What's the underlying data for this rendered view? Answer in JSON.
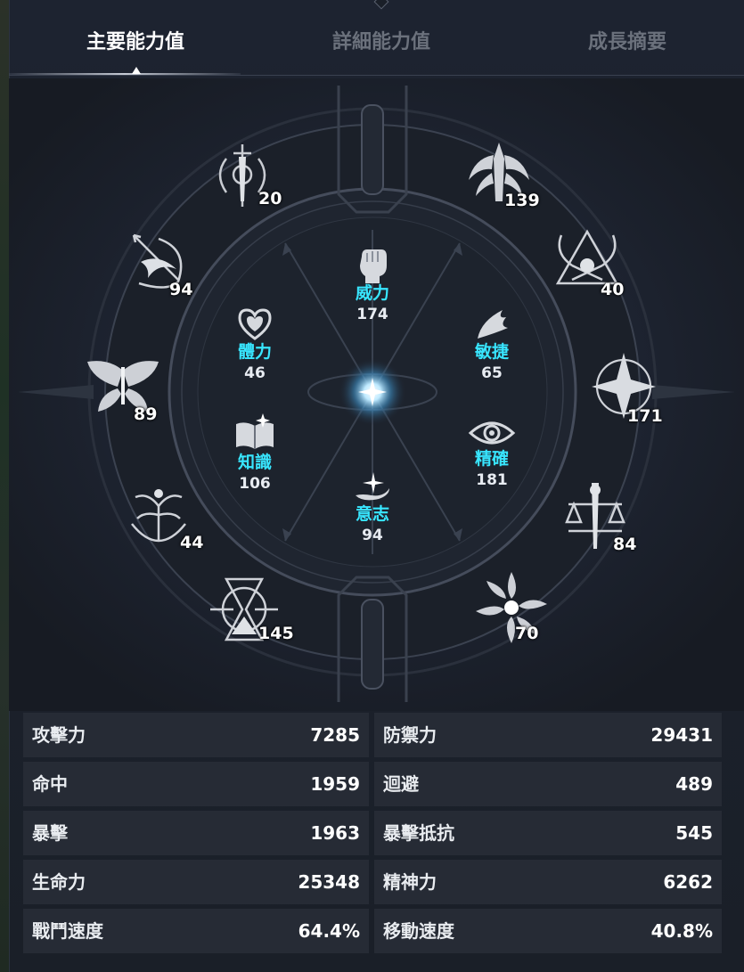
{
  "tabs": [
    {
      "label": "主要能力值",
      "active": true
    },
    {
      "label": "詳細能力值",
      "active": false
    },
    {
      "label": "成長摘要",
      "active": false
    }
  ],
  "outer_stats": [
    {
      "icon": "sword-crest-icon",
      "value": "20"
    },
    {
      "icon": "winged-blade-icon",
      "value": "139"
    },
    {
      "icon": "bow-arrow-icon",
      "value": "94"
    },
    {
      "icon": "crossed-scythes-icon",
      "value": "40"
    },
    {
      "icon": "butterfly-icon",
      "value": "89"
    },
    {
      "icon": "star-compass-icon",
      "value": "171"
    },
    {
      "icon": "tree-of-life-icon",
      "value": "44"
    },
    {
      "icon": "scales-sword-icon",
      "value": "84"
    },
    {
      "icon": "hourglass-icon",
      "value": "145"
    },
    {
      "icon": "radiant-sun-icon",
      "value": "70"
    }
  ],
  "inner_stats": [
    {
      "icon": "fist-icon",
      "name": "威力",
      "value": "174"
    },
    {
      "icon": "heart-icon",
      "name": "體力",
      "value": "46"
    },
    {
      "icon": "feather-claw-icon",
      "name": "敏捷",
      "value": "65"
    },
    {
      "icon": "open-book-icon",
      "name": "知識",
      "value": "106"
    },
    {
      "icon": "eye-icon",
      "name": "精確",
      "value": "181"
    },
    {
      "icon": "spark-swirl-icon",
      "name": "意志",
      "value": "94"
    }
  ],
  "stats_table": [
    {
      "label": "攻擊力",
      "value": "7285"
    },
    {
      "label": "防禦力",
      "value": "29431"
    },
    {
      "label": "命中",
      "value": "1959"
    },
    {
      "label": "迴避",
      "value": "489"
    },
    {
      "label": "暴擊",
      "value": "1963"
    },
    {
      "label": "暴擊抵抗",
      "value": "545"
    },
    {
      "label": "生命力",
      "value": "25348"
    },
    {
      "label": "精神力",
      "value": "6262"
    },
    {
      "label": "戰鬥速度",
      "value": "64.4%"
    },
    {
      "label": "移動速度",
      "value": "40.8%"
    }
  ],
  "colors": {
    "accent_cyan": "#38e6ff",
    "background": "#1c2129",
    "cell": "#262b35"
  }
}
